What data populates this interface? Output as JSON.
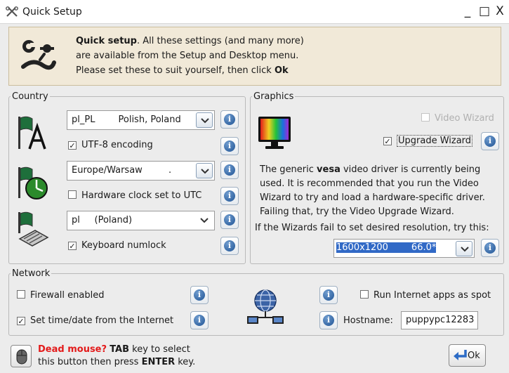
{
  "window": {
    "title": "Quick Setup",
    "minimize_label": "_",
    "maximize_label": "□",
    "close_label": "X"
  },
  "intro": {
    "bold": "Quick setup",
    "line1": ". All these settings (and many more)",
    "line2": "are available from the Setup and Desktop menu.",
    "line3_pre": "Please set these to suit yourself, then click ",
    "line3_bold": "Ok"
  },
  "country": {
    "legend": "Country",
    "locale_value": "pl_PL        Polish, Poland",
    "utf8_label": "UTF-8 encoding",
    "utf8_checked": true,
    "timezone_value": "Europe/Warsaw         .",
    "hwclock_label": "Hardware clock set to UTC",
    "hwclock_checked": false,
    "keyboard_value": "pl     (Poland)",
    "numlock_label": "Keyboard numlock",
    "numlock_checked": true
  },
  "graphics": {
    "legend": "Graphics",
    "video_wizard_label": "Video Wizard",
    "upgrade_wizard_label": "Upgrade Wizard",
    "upgrade_wizard_checked": true,
    "desc_pre": "The generic ",
    "desc_bold": "vesa",
    "desc_l1_post": " video driver is currently being",
    "desc_l2": "used. It is recommended that you run the Video",
    "desc_l3": "Wizard to try and load a hardware-specific driver.",
    "desc_l4": "Failing that, try the Video Upgrade Wizard.",
    "resolution_prompt": "If the Wizards fail to set desired resolution, try this:",
    "resolution_value": "1600x1200        66.0*"
  },
  "network": {
    "legend": "Network",
    "firewall_label": "Firewall enabled",
    "firewall_checked": false,
    "timedate_label": "Set time/date from the Internet",
    "timedate_checked": true,
    "spot_label": "Run Internet apps as spot",
    "spot_checked": false,
    "hostname_label": "Hostname:",
    "hostname_value": "puppypc12283"
  },
  "footer": {
    "dead_mouse": "Dead mouse?",
    "tab_bold": "TAB",
    "hint_l1_post": " key to select",
    "hint_l2_pre": "this button then press ",
    "enter_bold": "ENTER",
    "hint_l2_post": " key.",
    "ok_label": "Ok"
  },
  "info_glyph": "i",
  "check_glyph": "✓",
  "colors": {
    "banner_bg": "#f1e9d8",
    "selection": "#3169c6",
    "info_blue": "#1f5394",
    "warning_red": "#e31b1b"
  }
}
